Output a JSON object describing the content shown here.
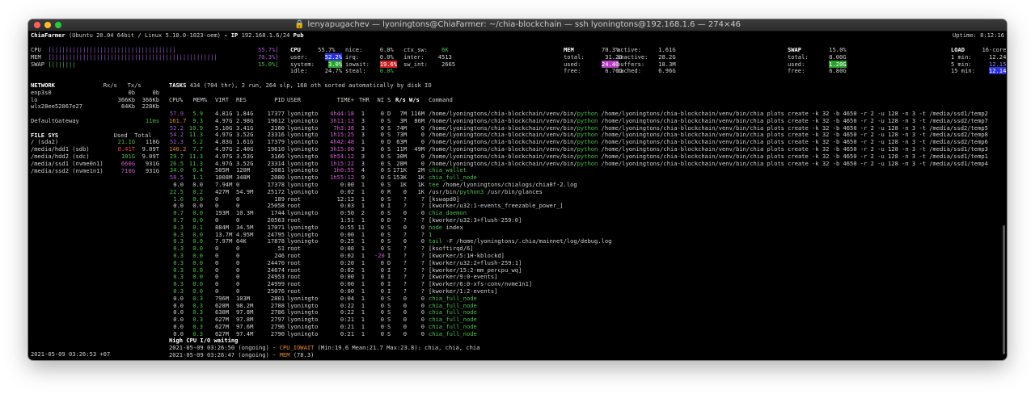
{
  "window": {
    "title": "lenyapugachev — lyoningtons@ChiaFarmer: ~/chia-blockchain — ssh lyoningtons@192.168.1.6 — 274×46"
  },
  "header": {
    "host": "ChiaFarmer",
    "os": "(Ubuntu 20.04 64bit / Linux 5.10.0-1023-oem)",
    "ip_label": "- IP",
    "ip": "192.168.1.6/24",
    "pub": "Pub",
    "uptime": "Uptime: 8:12:16"
  },
  "quicklook": {
    "cpu_label": "CPU",
    "cpu_bar": "[||||||||||||||||||||||||||||||||||||",
    "cpu_pct": "55.7%]",
    "mem_label": "MEM",
    "mem_bar": "[||||||||||||||||||||||||||||||||||||||||||||||||",
    "mem_pct": "70.3%]",
    "swap_label": "SWAP",
    "swap_bar": "[|||||||",
    "swap_pct": "15.0%]"
  },
  "cpu": {
    "title": "CPU",
    "total": "55.7%",
    "user_k": "user:",
    "user": "52.2%",
    "system_k": "system:",
    "system": "3.0%",
    "idle_k": "idle:",
    "idle": "24.7%",
    "nice_k": "nice:",
    "nice": "0.0%",
    "irq_k": "irq:",
    "irq": "0.0%",
    "iowait_k": "iowait:",
    "iowait": "19.6%",
    "steal_k": "steal:",
    "steal": "0.0%",
    "ctxsw_k": "ctx_sw:",
    "ctxsw": "6K",
    "inter_k": "inter:",
    "inter": "4513",
    "swint_k": "sw_int:",
    "swint": "2665"
  },
  "mem": {
    "title": "MEM",
    "pct": "70.3%",
    "total_k": "total:",
    "total": "31.2G",
    "used_k": "used:",
    "used": "24.4G",
    "free_k": "free:",
    "free": "6.76G",
    "active_k": "active:",
    "active": "1.61G",
    "inactive_k": "inactive:",
    "inactive": "28.2G",
    "buffers_k": "buffers:",
    "buffers": "18.3M",
    "cached_k": "cached:",
    "cached": "6.96G"
  },
  "swap": {
    "title": "SWAP",
    "pct": "15.0%",
    "total_k": "total:",
    "total": "8.00G",
    "used_k": "used:",
    "used": "1.20G",
    "free_k": "free:",
    "free": "6.80G"
  },
  "load": {
    "title": "LOAD",
    "cores": "16-core",
    "m1_k": "1 min:",
    "m1": "12.24",
    "m5_k": "5 min:",
    "m5": "12.15",
    "m15_k": "15 min:",
    "m15": "12.14"
  },
  "network": {
    "title": "NETWORK",
    "rx_h": "Rx/s",
    "tx_h": "Tx/s",
    "rows": [
      {
        "name": "enp3s0",
        "rx": "0b",
        "tx": "0b"
      },
      {
        "name": "lo",
        "rx": "366Kb",
        "tx": "366Kb"
      },
      {
        "name": "wlx28ee52067e27",
        "rx": "84Kb",
        "tx": "228Kb"
      }
    ],
    "gw_label": "DefaultGateway",
    "gw": "11ms"
  },
  "filesys": {
    "title": "FILE SYS",
    "used_h": "Used",
    "total_h": "Total",
    "rows": [
      {
        "name": "/ (sda2)",
        "used": "21.1G",
        "total": "116G",
        "color": "#49c24a"
      },
      {
        "name": "/media/hdd1 (sdb)",
        "used": "8.41T",
        "total": "9.09T",
        "color": "#ff3b3b"
      },
      {
        "name": "/media/hdd2 (sdc)",
        "used": "101G",
        "total": "9.09T",
        "color": "#49c24a"
      },
      {
        "name": "/media/ssd1 (nvme0n1)",
        "used": "660G",
        "total": "931G",
        "color": "#d35ad6"
      },
      {
        "name": "/media/ssd2 (nvme1n1)",
        "used": "710G",
        "total": "931G",
        "color": "#d35ad6"
      }
    ]
  },
  "timestamp": "2021-05-09 03:26:53 +07",
  "tasks": {
    "label": "TASKS",
    "summary": "434 (704 thr), 2 run, 264 slp, 168 oth sorted automatically by disk IO"
  },
  "columns": {
    "cpu": "CPU%",
    "mem": "MEM%",
    "virt": "VIRT",
    "res": "RES",
    "pid": "PID",
    "user": "USER",
    "time": "TIME+",
    "thr": "THR",
    "ni": "NI",
    "s": "S",
    "rs": "R/s",
    "ws": "W/s",
    "cmd": "Command"
  },
  "processes": [
    {
      "cpu": "57.9",
      "mem": "5.9",
      "virt": "4.81G",
      "res": "1.84G",
      "pid": "17377",
      "user": "lyoningto",
      "time": "4h44:18",
      "thr": "1",
      "ni": "0",
      "s": "D",
      "rs": "7M",
      "ws": "116M",
      "cmd_pre": "/home/lyoningtons/chia-blockchain/venv/bin/",
      "cmd_hi": "python",
      "cmd_post": " /home/lyoningtons/chia-blockchain/venv/bin/chia plots create -k 32 -b 4650 -r 2 -u 128 -n 3 -t /media/ssd1/temp2",
      "cc": "#a55bd8",
      "mc": "#49c24a",
      "tc": "#d35ad6",
      "hc": "#49c24a"
    },
    {
      "cpu": "161.7",
      "mem": "9.3",
      "virt": "4.97G",
      "res": "2.98G",
      "pid": "19612",
      "user": "lyoningto",
      "time": "3h11:13",
      "thr": "3",
      "ni": "0",
      "s": "S",
      "rs": "3M",
      "ws": "86M",
      "cmd_pre": "/home/lyoningtons/chia-blockchain/venv/bin/",
      "cmd_hi": "python",
      "cmd_post": " /home/lyoningtons/chia-blockchain/venv/bin/chia plots create -k 32 -b 4650 -r 2 -u 128 -n 3 -t /media/ssd2/temp7",
      "cc": "#e58a2e",
      "mc": "#49c24a",
      "tc": "#d35ad6",
      "hc": "#49c24a"
    },
    {
      "cpu": "52.2",
      "mem": "10.9",
      "virt": "5.10G",
      "res": "3.41G",
      "pid": "3160",
      "user": "lyoningto",
      "time": "7h3:38",
      "thr": "3",
      "ni": "0",
      "s": "S",
      "rs": "74M",
      "ws": "0",
      "cmd_pre": "/home/lyoningtons/chia-blockchain/venv/bin/",
      "cmd_hi": "python",
      "cmd_post": " /home/lyoningtons/chia-blockchain/venv/bin/chia plots create -k 32 -b 4650 -r 2 -u 128 -n 3 -t /media/ssd2/temp5",
      "cc": "#a55bd8",
      "mc": "#49c24a",
      "tc": "#d35ad6",
      "hc": "#49c24a"
    },
    {
      "cpu": "54.2",
      "mem": "11.3",
      "virt": "4.97G",
      "res": "3.52G",
      "pid": "23316",
      "user": "lyoningto",
      "time": "1h15:25",
      "thr": "3",
      "ni": "0",
      "s": "S",
      "rs": "73M",
      "ws": "0",
      "cmd_pre": "/home/lyoningtons/chia-blockchain/venv/bin/",
      "cmd_hi": "python",
      "cmd_post": " /home/lyoningtons/chia-blockchain/venv/bin/chia plots create -k 32 -b 4650 -r 2 -u 128 -n 3 -t /media/ssd2/temp8",
      "cc": "#a55bd8",
      "mc": "#49c24a",
      "tc": "#d35ad6",
      "hc": "#49c24a"
    },
    {
      "cpu": "52.3",
      "mem": "5.2",
      "virt": "4.83G",
      "res": "1.61G",
      "pid": "17379",
      "user": "lyoningto",
      "time": "4h42:48",
      "thr": "1",
      "ni": "0",
      "s": "D",
      "rs": "63M",
      "ws": "0",
      "cmd_pre": "/home/lyoningtons/chia-blockchain/venv/bin/",
      "cmd_hi": "python",
      "cmd_post": " /home/lyoningtons/chia-blockchain/venv/bin/chia plots create -k 32 -b 4650 -r 2 -u 128 -n 3 -t /media/ssd2/temp6",
      "cc": "#a55bd8",
      "mc": "#49c24a",
      "tc": "#d35ad6",
      "hc": "#49c24a"
    },
    {
      "cpu": "140.2",
      "mem": "7.7",
      "virt": "4.97G",
      "res": "2.40G",
      "pid": "19610",
      "user": "lyoningto",
      "time": "3h15:00",
      "thr": "3",
      "ni": "0",
      "s": "S",
      "rs": "11M",
      "ws": "49M",
      "cmd_pre": "/home/lyoningtons/chia-blockchain/venv/bin/",
      "cmd_hi": "python",
      "cmd_post": " /home/lyoningtons/chia-blockchain/venv/bin/chia plots create -k 32 -b 4650 -r 2 -u 128 -n 3 -t /media/ssd1/temp3",
      "cc": "#e58a2e",
      "mc": "#49c24a",
      "tc": "#d35ad6",
      "hc": "#49c24a"
    },
    {
      "cpu": "29.7",
      "mem": "11.3",
      "virt": "4.97G",
      "res": "3.53G",
      "pid": "3166",
      "user": "lyoningto",
      "time": "6h54:12",
      "thr": "3",
      "ni": "0",
      "s": "S",
      "rs": "30M",
      "ws": "0",
      "cmd_pre": "/home/lyoningtons/chia-blockchain/venv/bin/",
      "cmd_hi": "python",
      "cmd_post": " /home/lyoningtons/chia-blockchain/venv/bin/chia plots create -k 32 -b 4650 -r 2 -u 128 -n 3 -t /media/ssd1/temp1",
      "cc": "#49c24a",
      "mc": "#49c24a",
      "tc": "#d35ad6",
      "hc": "#49c24a"
    },
    {
      "cpu": "26.5",
      "mem": "11.3",
      "virt": "4.97G",
      "res": "3.52G",
      "pid": "23314",
      "user": "lyoningto",
      "time": "1h15:22",
      "thr": "3",
      "ni": "0",
      "s": "S",
      "rs": "28M",
      "ws": "0",
      "cmd_pre": "/home/lyoningtons/chia-blockchain/venv/bin/",
      "cmd_hi": "python",
      "cmd_post": " /home/lyoningtons/chia-blockchain/venv/bin/chia plots create -k 32 -b 4650 -r 2 -u 128 -n 3 -t /media/ssd1/temp4",
      "cc": "#49c24a",
      "mc": "#49c24a",
      "tc": "#d35ad6",
      "hc": "#49c24a"
    },
    {
      "cpu": "34.0",
      "mem": "0.4",
      "virt": "505M",
      "res": "120M",
      "pid": "2081",
      "user": "lyoningto",
      "time": "1h0:55",
      "thr": "4",
      "ni": "0",
      "s": "S",
      "rs": "171K",
      "ws": "2M",
      "cmd_pre": "",
      "cmd_hi": "chia_wallet",
      "cmd_post": "",
      "cc": "#49c24a",
      "mc": "#49c24a",
      "tc": "#d35ad6",
      "hc": "#49c24a"
    },
    {
      "cpu": "58.5",
      "mem": "1.1",
      "virt": "1008M",
      "res": "348M",
      "pid": "2080",
      "user": "lyoningto",
      "time": "1h55:12",
      "thr": "9",
      "ni": "0",
      "s": "S",
      "rs": "153K",
      "ws": "1K",
      "cmd_pre": "",
      "cmd_hi": "chia_full_node",
      "cmd_post": "",
      "cc": "#a55bd8",
      "mc": "#49c24a",
      "tc": "#d35ad6",
      "hc": "#49c24a"
    },
    {
      "cpu": "0.0",
      "mem": "0.0",
      "virt": "7.94M",
      "res": "0",
      "pid": "17378",
      "user": "lyoningto",
      "time": "0:00",
      "thr": "1",
      "ni": "0",
      "s": "S",
      "rs": "1K",
      "ws": "1K",
      "cmd_pre": "",
      "cmd_hi": "tee",
      "cmd_post": " /home/lyoningtons/chialogs/chia8f-2.log",
      "cc": "#d0d0d0",
      "mc": "#d0d0d0",
      "tc": "#d0d0d0",
      "hc": "#49c24a"
    },
    {
      "cpu": "22.5",
      "mem": "0.2",
      "virt": "427M",
      "res": "54.9M",
      "pid": "25172",
      "user": "lyoningto",
      "time": "0:02",
      "thr": "1",
      "ni": "0",
      "s": "R",
      "rs": "0",
      "ws": "1K",
      "cmd_pre": "/usr/bin/",
      "cmd_hi": "python3",
      "cmd_post": " /usr/bin/glances",
      "cc": "#49c24a",
      "mc": "#49c24a",
      "tc": "#d0d0d0",
      "hc": "#49c24a"
    },
    {
      "cpu": "1.6",
      "mem": "0.0",
      "virt": "0",
      "res": "0",
      "pid": "189",
      "user": "root",
      "time": "12:12",
      "thr": "1",
      "ni": "0",
      "s": "S",
      "rs": "?",
      "ws": "?",
      "cmd_pre": "[kswapd0]",
      "cmd_hi": "",
      "cmd_post": "",
      "cc": "#49c24a",
      "mc": "#49c24a",
      "tc": "#d0d0d0",
      "hc": "#49c24a"
    },
    {
      "cpu": "0.0",
      "mem": "0.0",
      "virt": "0",
      "res": "0",
      "pid": "25058",
      "user": "root",
      "time": "0:03",
      "thr": "1",
      "ni": "0",
      "s": "I",
      "rs": "?",
      "ws": "?",
      "cmd_pre": "[kworker/u32:1-events_freezable_power_]",
      "cmd_hi": "",
      "cmd_post": "",
      "cc": "#d0d0d0",
      "mc": "#d0d0d0",
      "tc": "#d0d0d0",
      "hc": "#49c24a"
    },
    {
      "cpu": "0.7",
      "mem": "0.0",
      "virt": "193M",
      "res": "10.3M",
      "pid": "1744",
      "user": "lyoningto",
      "time": "0:50",
      "thr": "2",
      "ni": "0",
      "s": "S",
      "rs": "0",
      "ws": "0",
      "cmd_pre": "",
      "cmd_hi": "chia_daemon",
      "cmd_post": "",
      "cc": "#49c24a",
      "mc": "#49c24a",
      "tc": "#d0d0d0",
      "hc": "#49c24a"
    },
    {
      "cpu": "0.7",
      "mem": "0.0",
      "virt": "0",
      "res": "0",
      "pid": "20563",
      "user": "root",
      "time": "1:51",
      "thr": "1",
      "ni": "0",
      "s": "D",
      "rs": "?",
      "ws": "?",
      "cmd_pre": "[kworker/u32:3+flush-259:0]",
      "cmd_hi": "",
      "cmd_post": "",
      "cc": "#49c24a",
      "mc": "#49c24a",
      "tc": "#d0d0d0",
      "hc": "#49c24a"
    },
    {
      "cpu": "0.3",
      "mem": "0.1",
      "virt": "884M",
      "res": "34.5M",
      "pid": "17071",
      "user": "lyoningto",
      "time": "0:55",
      "thr": "11",
      "ni": "0",
      "s": "S",
      "rs": "0",
      "ws": "0",
      "cmd_pre": "",
      "cmd_hi": "node",
      "cmd_post": " index",
      "cc": "#49c24a",
      "mc": "#49c24a",
      "tc": "#d0d0d0",
      "hc": "#49c24a"
    },
    {
      "cpu": "0.3",
      "mem": "0.0",
      "virt": "13.7M",
      "res": "4.95M",
      "pid": "24795",
      "user": "lyoningto",
      "time": "0:00",
      "thr": "1",
      "ni": "0",
      "s": "S",
      "rs": "?",
      "ws": "?",
      "cmd_pre": "",
      "cmd_hi": "1",
      "cmd_post": "",
      "cc": "#49c24a",
      "mc": "#49c24a",
      "tc": "#d0d0d0",
      "hc": "#49c24a"
    },
    {
      "cpu": "0.3",
      "mem": "0.0",
      "virt": "7.97M",
      "res": "64K",
      "pid": "17878",
      "user": "lyoningto",
      "time": "0:25",
      "thr": "1",
      "ni": "0",
      "s": "S",
      "rs": "0",
      "ws": "0",
      "cmd_pre": "",
      "cmd_hi": "tail",
      "cmd_post": " -F /home/lyoningtons/.chia/mainnet/log/debug.log",
      "cc": "#49c24a",
      "mc": "#49c24a",
      "tc": "#d0d0d0",
      "hc": "#49c24a"
    },
    {
      "cpu": "0.3",
      "mem": "0.0",
      "virt": "0",
      "res": "0",
      "pid": "51",
      "user": "root",
      "time": "0:00",
      "thr": "1",
      "ni": "0",
      "s": "S",
      "rs": "?",
      "ws": "?",
      "cmd_pre": "[ksoftirqd/6]",
      "cmd_hi": "",
      "cmd_post": "",
      "cc": "#49c24a",
      "mc": "#49c24a",
      "tc": "#d0d0d0",
      "hc": "#49c24a"
    },
    {
      "cpu": "0.3",
      "mem": "0.0",
      "virt": "0",
      "res": "0",
      "pid": "246",
      "user": "root",
      "time": "0:02",
      "thr": "1",
      "ni": "-20",
      "s": "I",
      "rs": "?",
      "ws": "?",
      "cmd_pre": "[kworker/5:1H-kblockd]",
      "cmd_hi": "",
      "cmd_post": "",
      "cc": "#49c24a",
      "mc": "#49c24a",
      "tc": "#d0d0d0",
      "hc": "#49c24a"
    },
    {
      "cpu": "0.3",
      "mem": "0.0",
      "virt": "0",
      "res": "0",
      "pid": "24470",
      "user": "root",
      "time": "0:20",
      "thr": "1",
      "ni": "0",
      "s": "D",
      "rs": "?",
      "ws": "?",
      "cmd_pre": "[kworker/u32:2+flush-259:1]",
      "cmd_hi": "",
      "cmd_post": "",
      "cc": "#49c24a",
      "mc": "#49c24a",
      "tc": "#d0d0d0",
      "hc": "#49c24a"
    },
    {
      "cpu": "0.3",
      "mem": "0.0",
      "virt": "0",
      "res": "0",
      "pid": "24674",
      "user": "root",
      "time": "0:02",
      "thr": "1",
      "ni": "0",
      "s": "I",
      "rs": "?",
      "ws": "?",
      "cmd_pre": "[kworker/15:2-mm_percpu_wq]",
      "cmd_hi": "",
      "cmd_post": "",
      "cc": "#49c24a",
      "mc": "#49c24a",
      "tc": "#d0d0d0",
      "hc": "#49c24a"
    },
    {
      "cpu": "0.3",
      "mem": "0.0",
      "virt": "0",
      "res": "0",
      "pid": "24953",
      "user": "root",
      "time": "0:00",
      "thr": "1",
      "ni": "0",
      "s": "I",
      "rs": "?",
      "ws": "?",
      "cmd_pre": "[kworker/9:0-events]",
      "cmd_hi": "",
      "cmd_post": "",
      "cc": "#49c24a",
      "mc": "#49c24a",
      "tc": "#d0d0d0",
      "hc": "#49c24a"
    },
    {
      "cpu": "0.3",
      "mem": "0.0",
      "virt": "0",
      "res": "0",
      "pid": "24999",
      "user": "root",
      "time": "0:00",
      "thr": "1",
      "ni": "0",
      "s": "I",
      "rs": "?",
      "ws": "?",
      "cmd_pre": "[kworker/6:0-xfs-conv/nvme1n1]",
      "cmd_hi": "",
      "cmd_post": "",
      "cc": "#49c24a",
      "mc": "#49c24a",
      "tc": "#d0d0d0",
      "hc": "#49c24a"
    },
    {
      "cpu": "0.3",
      "mem": "0.0",
      "virt": "0",
      "res": "0",
      "pid": "25076",
      "user": "root",
      "time": "0:00",
      "thr": "1",
      "ni": "0",
      "s": "I",
      "rs": "?",
      "ws": "?",
      "cmd_pre": "[kworker/1:2-events]",
      "cmd_hi": "",
      "cmd_post": "",
      "cc": "#49c24a",
      "mc": "#49c24a",
      "tc": "#d0d0d0",
      "hc": "#49c24a"
    },
    {
      "cpu": "0.0",
      "mem": "0.3",
      "virt": "796M",
      "res": "103M",
      "pid": "2801",
      "user": "lyoningto",
      "time": "0:04",
      "thr": "1",
      "ni": "0",
      "s": "S",
      "rs": "0",
      "ws": "0",
      "cmd_pre": "",
      "cmd_hi": "chia_full_node",
      "cmd_post": "",
      "cc": "#d0d0d0",
      "mc": "#49c24a",
      "tc": "#d0d0d0",
      "hc": "#49c24a"
    },
    {
      "cpu": "0.0",
      "mem": "0.3",
      "virt": "628M",
      "res": "98.2M",
      "pid": "2788",
      "user": "lyoningto",
      "time": "0:22",
      "thr": "1",
      "ni": "0",
      "s": "S",
      "rs": "0",
      "ws": "0",
      "cmd_pre": "",
      "cmd_hi": "chia_full_node",
      "cmd_post": "",
      "cc": "#d0d0d0",
      "mc": "#49c24a",
      "tc": "#d0d0d0",
      "hc": "#49c24a"
    },
    {
      "cpu": "0.0",
      "mem": "0.3",
      "virt": "630M",
      "res": "97.8M",
      "pid": "2786",
      "user": "lyoningto",
      "time": "0:22",
      "thr": "1",
      "ni": "0",
      "s": "S",
      "rs": "0",
      "ws": "0",
      "cmd_pre": "",
      "cmd_hi": "chia_full_node",
      "cmd_post": "",
      "cc": "#d0d0d0",
      "mc": "#49c24a",
      "tc": "#d0d0d0",
      "hc": "#49c24a"
    },
    {
      "cpu": "0.0",
      "mem": "0.3",
      "virt": "627M",
      "res": "97.8M",
      "pid": "2797",
      "user": "lyoningto",
      "time": "0:21",
      "thr": "1",
      "ni": "0",
      "s": "S",
      "rs": "0",
      "ws": "0",
      "cmd_pre": "",
      "cmd_hi": "chia_full_node",
      "cmd_post": "",
      "cc": "#d0d0d0",
      "mc": "#49c24a",
      "tc": "#d0d0d0",
      "hc": "#49c24a"
    },
    {
      "cpu": "0.0",
      "mem": "0.3",
      "virt": "627M",
      "res": "97.6M",
      "pid": "2796",
      "user": "lyoningto",
      "time": "0:21",
      "thr": "1",
      "ni": "0",
      "s": "S",
      "rs": "0",
      "ws": "0",
      "cmd_pre": "",
      "cmd_hi": "chia_full_node",
      "cmd_post": "",
      "cc": "#d0d0d0",
      "mc": "#49c24a",
      "tc": "#d0d0d0",
      "hc": "#49c24a"
    },
    {
      "cpu": "0.0",
      "mem": "0.3",
      "virt": "627M",
      "res": "97.4M",
      "pid": "2790",
      "user": "lyoningto",
      "time": "0:21",
      "thr": "1",
      "ni": "0",
      "s": "S",
      "rs": "0",
      "ws": "0",
      "cmd_pre": "",
      "cmd_hi": "chia_full_node",
      "cmd_post": "",
      "cc": "#d0d0d0",
      "mc": "#49c24a",
      "tc": "#d0d0d0",
      "hc": "#49c24a"
    }
  ],
  "alerts": {
    "title": "High CPU I/O waiting",
    "a1_time": "2021-05-09 03:26:50 (ongoing) - ",
    "a1_type": "CPU_IOWAIT",
    "a1_rest": " (Min:19.6 Mean:21.7 Max:23.8): chia, chia, chia",
    "a2_time": "2021-05-09 03:26:47 (ongoing) - ",
    "a2_type": "MEM",
    "a2_rest": " (78.3)"
  }
}
